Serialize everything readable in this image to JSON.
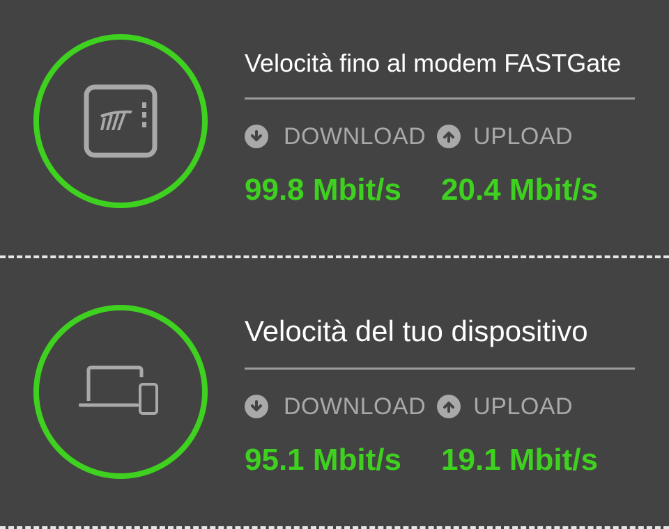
{
  "sections": [
    {
      "title": "Velocità fino al modem FASTGate",
      "icon": "modem-icon",
      "download_label": "DOWNLOAD",
      "upload_label": "UPLOAD",
      "download_value": "99.8 Mbit/s",
      "upload_value": "20.4 Mbit/s"
    },
    {
      "title": "Velocità del tuo dispositivo",
      "icon": "devices-icon",
      "download_label": "DOWNLOAD",
      "upload_label": "UPLOAD",
      "download_value": "95.1 Mbit/s",
      "upload_value": "19.1 Mbit/s"
    }
  ],
  "colors": {
    "background": "#434343",
    "accent_green": "#3fd11f",
    "muted_gray": "#a9a9a9",
    "divider_dashes": "#e6e6e6"
  }
}
